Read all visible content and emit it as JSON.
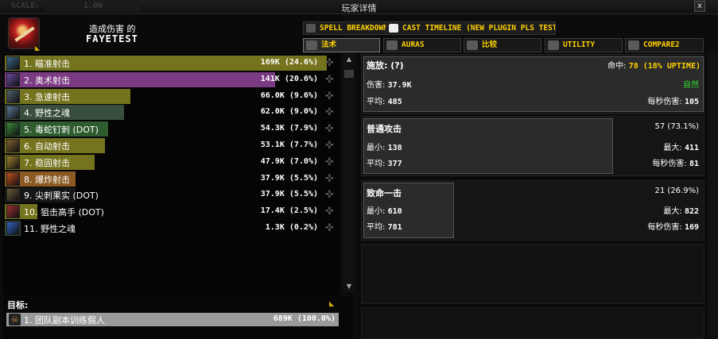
{
  "window": {
    "scale_label": "SCALE:",
    "scale_value": "1.00",
    "title": "玩家详情",
    "close": "x"
  },
  "header": {
    "caption": "造成伤害 的",
    "player_name": "FAYETEST"
  },
  "tabs_top": [
    {
      "label": "SPELL BREAKDOWN"
    },
    {
      "label": "CAST TIMELINE (NEW PLUGIN PLS TEST)"
    }
  ],
  "tabs_bottom": [
    {
      "label": "法术"
    },
    {
      "label": "AURAS"
    },
    {
      "label": "比较"
    },
    {
      "label": "UTILITY"
    },
    {
      "label": "COMPARE2"
    }
  ],
  "spells": [
    {
      "label": "1. 瞄准射击",
      "amount": "169K (24.6%)",
      "fraction": 1.0,
      "bar_color": "#74731e",
      "icon_color": "#3a6a8a"
    },
    {
      "label": "2. 奥术射击",
      "amount": "141K (20.6%)",
      "fraction": 0.84,
      "bar_color": "#7b3b83",
      "icon_color": "#6a4aa0"
    },
    {
      "label": "3. 急速射击",
      "amount": "66.0K (9.6%)",
      "fraction": 0.39,
      "bar_color": "#74731e",
      "icon_color": "#506070"
    },
    {
      "label": "4. 野性之魂",
      "amount": "62.0K (9.0%)",
      "fraction": 0.37,
      "bar_color": "#3a4e3e",
      "icon_color": "#5a7a9a"
    },
    {
      "label": "5. 毒蛇钉刺 (DOT)",
      "amount": "54.3K (7.9%)",
      "fraction": 0.32,
      "bar_color": "#2f5c2f",
      "icon_color": "#3a8a3a"
    },
    {
      "label": "6. 自动射击",
      "amount": "53.1K (7.7%)",
      "fraction": 0.31,
      "bar_color": "#74731e",
      "icon_color": "#806030"
    },
    {
      "label": "7. 稳固射击",
      "amount": "47.9K (7.0%)",
      "fraction": 0.28,
      "bar_color": "#74731e",
      "icon_color": "#a08030"
    },
    {
      "label": "8. 爆炸射击",
      "amount": "37.9K (5.5%)",
      "fraction": 0.22,
      "bar_color": "#8a5a22",
      "icon_color": "#c05020"
    },
    {
      "label": "9. 尖刺果实 (DOT)",
      "amount": "37.9K (5.5%)",
      "fraction": 0.22,
      "bar_color": "#161616",
      "icon_color": "#6a5a3a"
    },
    {
      "label": "10. 狙击高手 (DOT)",
      "amount": "17.4K (2.5%)",
      "fraction": 0.1,
      "bar_color": "#74731e",
      "icon_color": "#a03030"
    },
    {
      "label": "11. 野性之魂",
      "amount": "1.3K (0.2%)",
      "fraction": 0.008,
      "bar_color": "#3a4e3e",
      "icon_color": "#3060c0"
    }
  ],
  "targets": {
    "label": "目标:",
    "rows": [
      {
        "label": "1. 团队副本训练假人",
        "amount": "689K (100.0%)"
      }
    ]
  },
  "detail": {
    "cast": {
      "title": "施放: (?)",
      "hit_label": "命中:",
      "hit_value": "78 (18% UPTIME)",
      "damage_label": "伤害:",
      "damage_value": "37.9K",
      "school": "自然",
      "avg_label": "平均:",
      "avg_value": "485",
      "dps_label": "每秒伤害:",
      "dps_value": "105"
    },
    "normal": {
      "title": "普通攻击",
      "count": "57 (73.1%)",
      "min_label": "最小:",
      "min_value": "138",
      "max_label": "最大:",
      "max_value": "411",
      "avg_label": "平均:",
      "avg_value": "377",
      "dps_label": "每秒伤害:",
      "dps_value": "81"
    },
    "crit": {
      "title": "致命一击",
      "count": "21 (26.9%)",
      "min_label": "最小:",
      "min_value": "610",
      "max_label": "最大:",
      "max_value": "822",
      "avg_label": "平均:",
      "avg_value": "781",
      "dps_label": "每秒伤害:",
      "dps_value": "169"
    }
  },
  "colors": {
    "accent": "#ffd100",
    "nature": "#33dd33"
  }
}
